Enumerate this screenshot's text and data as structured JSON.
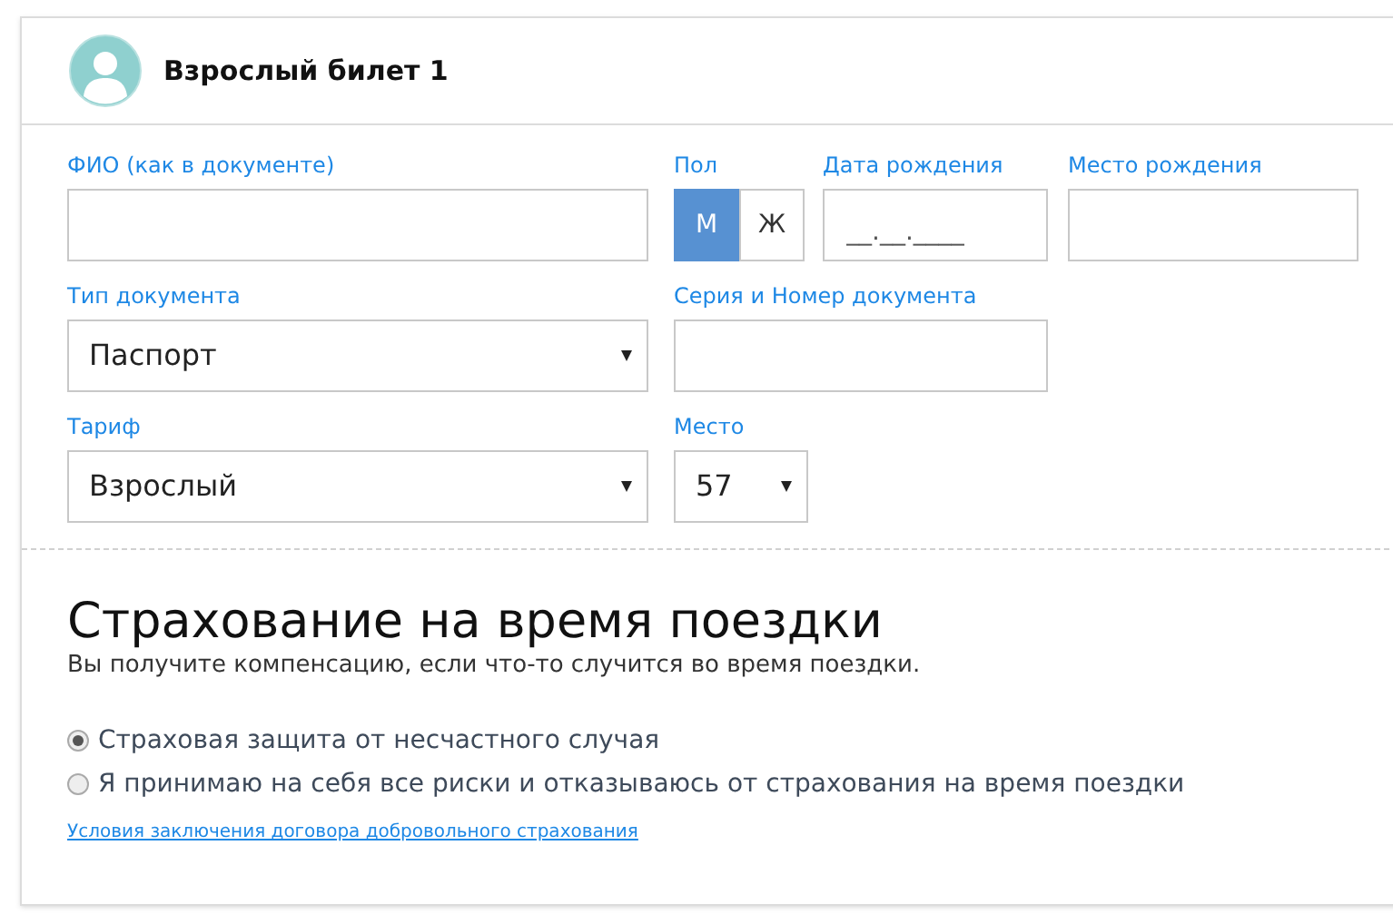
{
  "header": {
    "title": "Взрослый билет 1"
  },
  "fields": {
    "full_name": {
      "label": "ФИО (как в документе)"
    },
    "gender": {
      "label": "Пол",
      "options": [
        {
          "label": "М",
          "selected": true
        },
        {
          "label": "Ж",
          "selected": false
        }
      ]
    },
    "birth_date": {
      "label": "Дата рождения",
      "placeholder": "__.__.____"
    },
    "birth_place": {
      "label": "Место рождения"
    },
    "document_type": {
      "label": "Тип документа",
      "value": "Паспорт"
    },
    "document_number": {
      "label": "Серия и Номер документа"
    },
    "tariff": {
      "label": "Тариф",
      "value": "Взрослый"
    },
    "seat": {
      "label": "Место",
      "value": "57"
    }
  },
  "insurance": {
    "title": "Страхование на время поездки",
    "subtitle": "Вы получите компенсацию, если что-то случится во время поездки.",
    "options": [
      {
        "label": "Страховая защита от несчастного случая",
        "selected": true
      },
      {
        "label": "Я принимаю на себя все риски и отказываюсь от страхования на время поездки",
        "selected": false
      }
    ],
    "link": "Условия заключения договора добровольного страхования"
  }
}
